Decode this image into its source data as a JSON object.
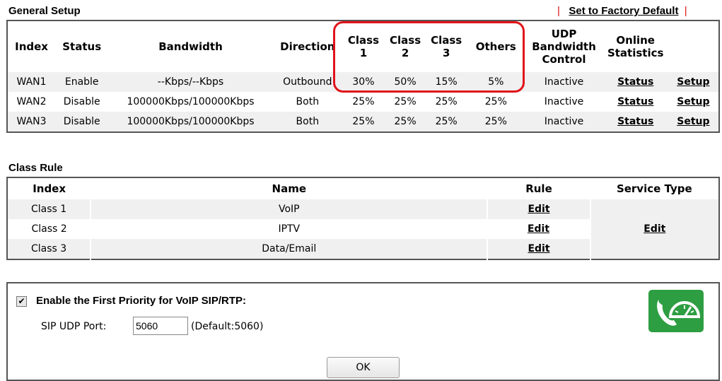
{
  "general": {
    "title": "General Setup",
    "factory_sep1": "|",
    "factory_label": "Set to Factory Default",
    "factory_sep2": "|",
    "headers": {
      "index": "Index",
      "status": "Status",
      "bandwidth": "Bandwidth",
      "direction": "Direction",
      "class1_a": "Class",
      "class1_b": "1",
      "class2_a": "Class",
      "class2_b": "2",
      "class3_a": "Class",
      "class3_b": "3",
      "others": "Others",
      "udp_a": "UDP",
      "udp_b": "Bandwidth",
      "udp_c": "Control",
      "online_a": "Online",
      "online_b": "Statistics"
    },
    "rows": [
      {
        "index": "WAN1",
        "status": "Enable",
        "bandwidth": "--Kbps/--Kbps",
        "direction": "Outbound",
        "c1": "30%",
        "c2": "50%",
        "c3": "15%",
        "others": "5%",
        "udp": "Inactive",
        "stat": "Status",
        "setup": "Setup"
      },
      {
        "index": "WAN2",
        "status": "Disable",
        "bandwidth": "100000Kbps/100000Kbps",
        "direction": "Both",
        "c1": "25%",
        "c2": "25%",
        "c3": "25%",
        "others": "25%",
        "udp": "Inactive",
        "stat": "Status",
        "setup": "Setup"
      },
      {
        "index": "WAN3",
        "status": "Disable",
        "bandwidth": "100000Kbps/100000Kbps",
        "direction": "Both",
        "c1": "25%",
        "c2": "25%",
        "c3": "25%",
        "others": "25%",
        "udp": "Inactive",
        "stat": "Status",
        "setup": "Setup"
      }
    ]
  },
  "class_rule": {
    "title": "Class Rule",
    "headers": {
      "index": "Index",
      "name": "Name",
      "rule": "Rule",
      "service": "Service Type"
    },
    "rows": [
      {
        "index": "Class 1",
        "name": "VoIP",
        "rule": "Edit"
      },
      {
        "index": "Class 2",
        "name": "IPTV",
        "rule": "Edit"
      },
      {
        "index": "Class 3",
        "name": "Data/Email",
        "rule": "Edit"
      }
    ],
    "service_edit": "Edit"
  },
  "voip": {
    "checkbox_label": "Enable the First Priority for VoIP SIP/RTP:",
    "checked": true,
    "port_label": "SIP UDP Port:",
    "port_value": "5060",
    "default_text": "(Default:5060)",
    "ok_label": "OK",
    "icon": "voip-speedometer-icon"
  },
  "colors": {
    "highlight": "#e0141b",
    "icon_bg": "#2e9e42",
    "factory_bar": "#dd1111"
  }
}
